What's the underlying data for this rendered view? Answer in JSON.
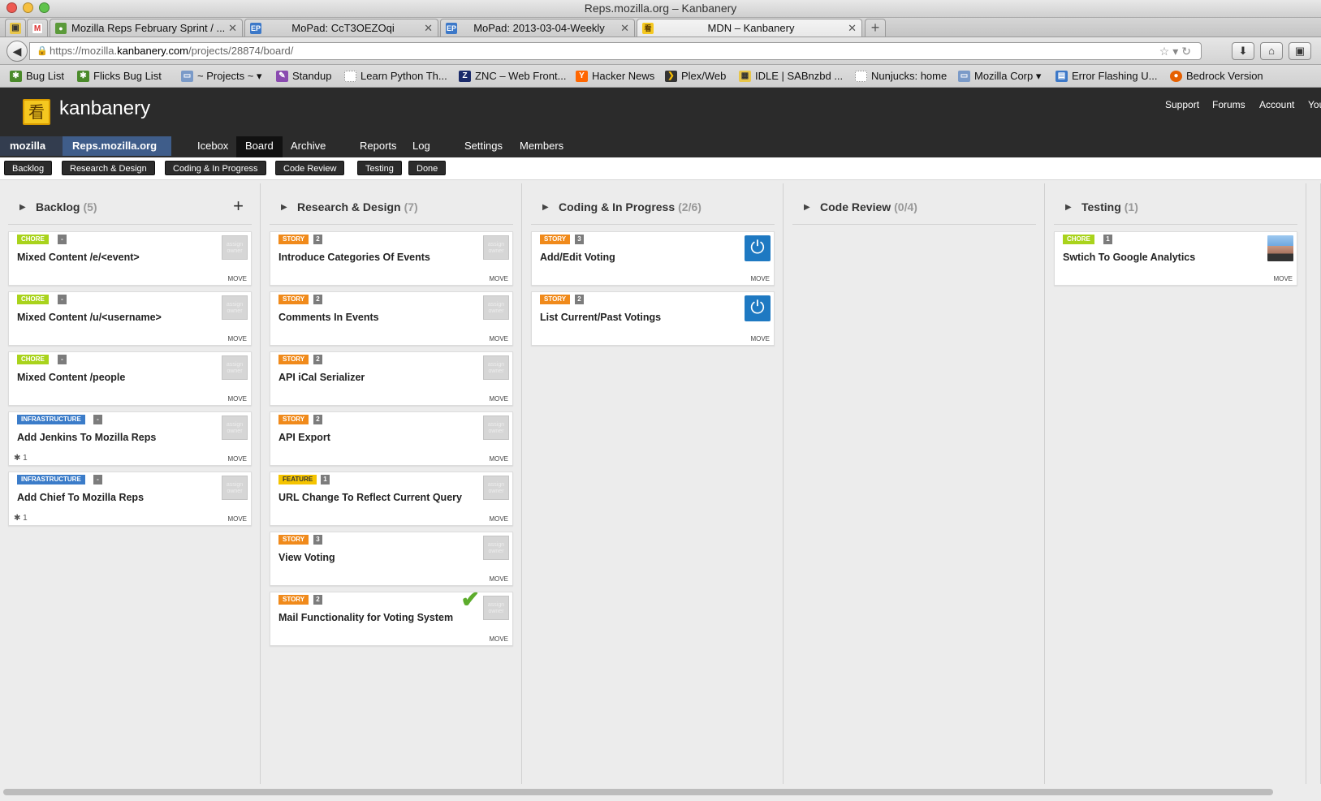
{
  "window": {
    "title": "Reps.mozilla.org – Kanbanery"
  },
  "tabs": [
    {
      "title": "Mozilla Reps February Sprint / ...",
      "icon": "bugzilla-icon",
      "active": false
    },
    {
      "title": "MoPad: CcT3OEZOqi",
      "icon": "etherpad-icon",
      "active": false
    },
    {
      "title": "MoPad: 2013-03-04-Weekly",
      "icon": "etherpad-icon",
      "active": false
    },
    {
      "title": "MDN – Kanbanery",
      "icon": "kanbanery-icon",
      "active": true
    }
  ],
  "url": {
    "prefix": "https://mozilla.",
    "domain": "kanbanery.com",
    "path": "/projects/28874/board/"
  },
  "bookmarks": [
    "Bug List",
    "Flicks Bug List",
    "~ Projects ~",
    "Standup",
    "Learn Python Th...",
    "ZNC – Web Front...",
    "Hacker News",
    "Plex/Web",
    "IDLE | SABnzbd ...",
    "Nunjucks: home",
    "Mozilla Corp",
    "Error Flashing U...",
    "Bedrock Version"
  ],
  "brand": {
    "name": "kanbanery",
    "logo_glyph": "看"
  },
  "toplinks": [
    "Support",
    "Forums",
    "Account",
    "You"
  ],
  "project_nav": {
    "org": "mozilla ▾",
    "project": "Reps.mozilla.org ▾",
    "tabs": [
      "Icebox",
      "Board",
      "Archive",
      "Reports",
      "Log",
      "Settings",
      "Members"
    ],
    "active_tab": "Board"
  },
  "column_buttons": [
    "Backlog",
    "Research & Design",
    "Coding & In Progress",
    "Code Review",
    "Testing",
    "Done"
  ],
  "columns": [
    {
      "name": "Backlog",
      "count": "(5)",
      "has_add": true,
      "cards": [
        {
          "type": "CHORE",
          "est": "-",
          "title": "Mixed Content /e/<event>",
          "owner": "assign owner",
          "move": "MOVE"
        },
        {
          "type": "CHORE",
          "est": "-",
          "title": "Mixed Content /u/<username>",
          "owner": "assign owner",
          "move": "MOVE"
        },
        {
          "type": "CHORE",
          "est": "-",
          "title": "Mixed Content /people",
          "owner": "assign owner",
          "move": "MOVE"
        },
        {
          "type": "INFRASTRUCTURE",
          "est": "-",
          "title": "Add Jenkins To Mozilla Reps",
          "owner": "assign owner",
          "move": "MOVE",
          "bugs": "1"
        },
        {
          "type": "INFRASTRUCTURE",
          "est": "-",
          "title": "Add Chief To Mozilla Reps",
          "owner": "assign owner",
          "move": "MOVE",
          "bugs": "1"
        }
      ]
    },
    {
      "name": "Research & Design",
      "count": "(7)",
      "cards": [
        {
          "type": "STORY",
          "est": "2",
          "title": "Introduce Categories Of Events",
          "owner": "assign owner",
          "move": "MOVE"
        },
        {
          "type": "STORY",
          "est": "2",
          "title": "Comments In Events",
          "owner": "assign owner",
          "move": "MOVE"
        },
        {
          "type": "STORY",
          "est": "2",
          "title": "API iCal Serializer",
          "owner": "assign owner",
          "move": "MOVE"
        },
        {
          "type": "STORY",
          "est": "2",
          "title": "API Export",
          "owner": "assign owner",
          "move": "MOVE"
        },
        {
          "type": "FEATURE",
          "est": "1",
          "title": "URL Change To Reflect Current Query",
          "owner": "assign owner",
          "move": "MOVE"
        },
        {
          "type": "STORY",
          "est": "3",
          "title": "View Voting",
          "owner": "assign owner",
          "move": "MOVE"
        },
        {
          "type": "STORY",
          "est": "2",
          "title": "Mail Functionality for Voting System",
          "owner": "assign owner",
          "move": "MOVE",
          "checked": true
        }
      ]
    },
    {
      "name": "Coding & In Progress",
      "count": "(2/6)",
      "cards": [
        {
          "type": "STORY",
          "est": "3",
          "title": "Add/Edit Voting",
          "owner_avatar": "power-icon",
          "move": "MOVE"
        },
        {
          "type": "STORY",
          "est": "2",
          "title": "List Current/Past Votings",
          "owner_avatar": "power-icon",
          "move": "MOVE"
        }
      ]
    },
    {
      "name": "Code Review",
      "count": "(0/4)",
      "cards": []
    },
    {
      "name": "Testing",
      "count": "(1)",
      "cards": [
        {
          "type": "CHORE",
          "est": "1",
          "title": "Swtich To Google Analytics",
          "owner_avatar": "user-photo",
          "move": "MOVE"
        }
      ]
    }
  ],
  "colors": {
    "chore": "#a9d31c",
    "story": "#f08a1b",
    "feature": "#f5c400",
    "infrastructure": "#3b7cc9",
    "header": "#2b2b2b"
  }
}
